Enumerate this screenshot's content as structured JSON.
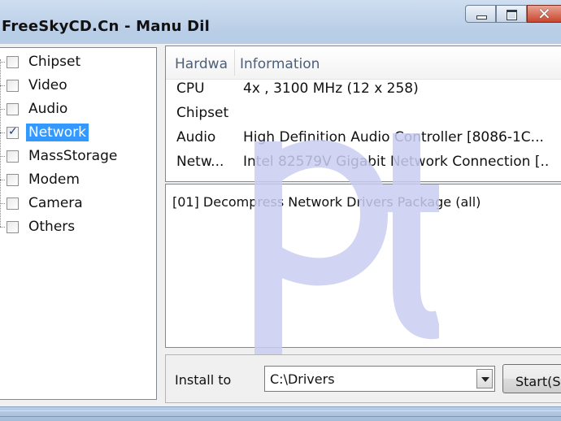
{
  "window": {
    "title": "FreeSkyCD.Cn - Manu Dil"
  },
  "tree": {
    "items": [
      {
        "label": "Chipset",
        "checked": false,
        "selected": false
      },
      {
        "label": "Video",
        "checked": false,
        "selected": false
      },
      {
        "label": "Audio",
        "checked": false,
        "selected": false
      },
      {
        "label": "Network",
        "checked": true,
        "selected": true
      },
      {
        "label": "MassStorage",
        "checked": false,
        "selected": false
      },
      {
        "label": "Modem",
        "checked": false,
        "selected": false
      },
      {
        "label": "Camera",
        "checked": false,
        "selected": false
      },
      {
        "label": "Others",
        "checked": false,
        "selected": false
      }
    ]
  },
  "hardware_list": {
    "columns": [
      "Hardwa",
      "Information"
    ],
    "rows": [
      {
        "hardware": "CPU",
        "info": "4x , 3100 MHz (12 x 258)"
      },
      {
        "hardware": "Chipset",
        "info": ""
      },
      {
        "hardware": "Audio",
        "info": "High Definition Audio Controller [8086-1C..."
      },
      {
        "hardware": "Netw...",
        "info": "Intel 82579V Gigabit Network Connection [..."
      }
    ]
  },
  "log": {
    "lines": [
      "[01] Decompress Network Drivers Package (all)"
    ]
  },
  "install": {
    "label": "Install to",
    "path": "C:\\Drivers",
    "start_label": "Start(S)"
  },
  "icons": {
    "minimize": "minimize-icon",
    "maximize": "maximize-icon",
    "close": "close-icon",
    "dropdown": "chevron-down-icon"
  },
  "colors": {
    "selection": "#3399ff",
    "watermark": "#c9cdf0",
    "close_button": "#c9452c"
  }
}
